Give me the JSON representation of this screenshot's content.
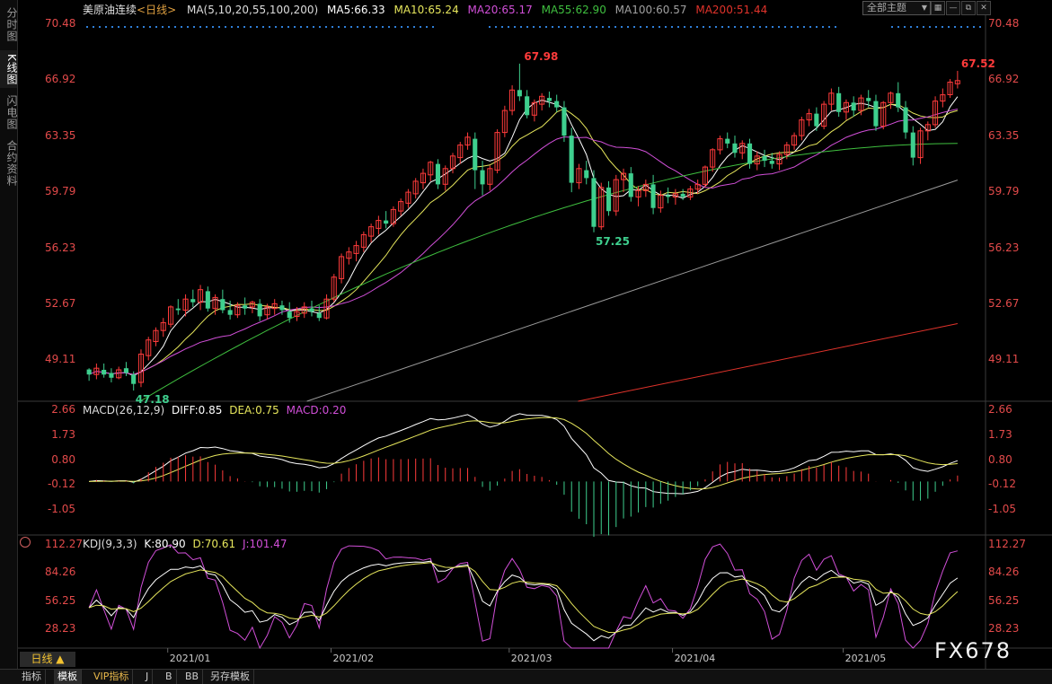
{
  "sidebar": {
    "tabs": [
      {
        "label": "分时图"
      },
      {
        "label": "K线图"
      },
      {
        "label": "闪电图"
      },
      {
        "label": "合约资料"
      }
    ]
  },
  "header": {
    "instrument": "美原油连续",
    "period_tag": "<日线>",
    "ma_params": "MA(5,10,20,55,100,200)",
    "ma5": "MA5:66.33",
    "ma10": "MA10:65.24",
    "ma20": "MA20:65.17",
    "ma55": "MA55:62.90",
    "ma100": "MA100:60.57",
    "ma200": "MA200:51.44",
    "theme_select": "全部主题",
    "theme_arrow": "▼"
  },
  "colors": {
    "up": "#ff3b3b",
    "down": "#3ecf8e",
    "ma5": "#ffffff",
    "ma10": "#e6e65c",
    "ma20": "#d14fd8",
    "ma55": "#3fbf3f",
    "ma100": "#9a9a9a",
    "ma200": "#e0332b",
    "axis_text": "#e34a4a",
    "grid_dots": "#2f7fd8"
  },
  "price_axis": {
    "labels": [
      "70.48",
      "66.92",
      "63.35",
      "59.79",
      "56.23",
      "52.67",
      "49.11"
    ]
  },
  "price_marks": {
    "high_label": "67.98",
    "low_label": "57.25",
    "first_low_label": "47.18",
    "last_label": "67.52"
  },
  "macd": {
    "title": "MACD(26,12,9)",
    "diff": "DIFF:0.85",
    "dea": "DEA:0.75",
    "macd": "MACD:0.20",
    "axis_labels": [
      "2.66",
      "1.73",
      "0.80",
      "-0.12",
      "-1.05"
    ]
  },
  "kdj": {
    "title": "KDJ(9,3,3)",
    "k": "K:80.90",
    "d": "D:70.61",
    "j": "J:101.47",
    "axis_labels": [
      "112.27",
      "84.26",
      "56.25",
      "28.23"
    ]
  },
  "dates": [
    "2021/01",
    "2021/02",
    "2021/03",
    "2021/04",
    "2021/05"
  ],
  "period_button": "日线 ▲",
  "bottom_tabs": [
    "指标",
    "模板",
    "VIP指标",
    "J",
    "B",
    "BB",
    "另存模板"
  ],
  "watermark": "FX678",
  "chart_data": {
    "type": "candlestick",
    "ohlc": [
      [
        48.52,
        48.6,
        47.8,
        48.2
      ],
      [
        48.2,
        48.9,
        47.9,
        48.6
      ],
      [
        48.5,
        48.9,
        48.0,
        48.2
      ],
      [
        48.3,
        48.6,
        47.7,
        48.0
      ],
      [
        48.0,
        48.7,
        47.9,
        48.5
      ],
      [
        48.6,
        49.0,
        48.1,
        48.3
      ],
      [
        48.2,
        48.4,
        47.18,
        47.6
      ],
      [
        47.7,
        49.8,
        47.4,
        49.5
      ],
      [
        49.4,
        50.6,
        49.1,
        50.4
      ],
      [
        50.3,
        51.2,
        50.0,
        51.0
      ],
      [
        51.0,
        51.8,
        50.6,
        51.5
      ],
      [
        51.4,
        52.6,
        51.2,
        52.5
      ],
      [
        52.4,
        53.0,
        52.0,
        52.3
      ],
      [
        52.3,
        53.3,
        51.9,
        53.0
      ],
      [
        53.0,
        53.6,
        52.5,
        52.8
      ],
      [
        52.8,
        53.9,
        52.3,
        53.6
      ],
      [
        53.5,
        53.8,
        52.2,
        52.4
      ],
      [
        52.4,
        53.3,
        52.0,
        53.1
      ],
      [
        53.0,
        53.6,
        52.1,
        52.3
      ],
      [
        52.3,
        52.9,
        51.7,
        52.0
      ],
      [
        52.0,
        52.8,
        51.8,
        52.6
      ],
      [
        52.6,
        53.1,
        52.0,
        52.4
      ],
      [
        52.5,
        52.9,
        52.1,
        52.8
      ],
      [
        52.7,
        53.0,
        51.6,
        51.9
      ],
      [
        52.0,
        52.7,
        51.7,
        52.5
      ],
      [
        52.4,
        53.0,
        52.0,
        52.7
      ],
      [
        52.6,
        52.9,
        52.0,
        52.3
      ],
      [
        52.2,
        52.8,
        51.5,
        51.8
      ],
      [
        51.9,
        52.5,
        51.6,
        52.2
      ],
      [
        52.1,
        52.8,
        51.8,
        52.5
      ],
      [
        52.4,
        52.9,
        51.9,
        52.2
      ],
      [
        52.1,
        52.6,
        51.6,
        51.8
      ],
      [
        51.8,
        53.3,
        51.7,
        53.0
      ],
      [
        53.0,
        54.6,
        52.8,
        54.4
      ],
      [
        54.3,
        55.9,
        54.0,
        55.7
      ],
      [
        55.6,
        56.3,
        55.2,
        56.0
      ],
      [
        55.9,
        56.7,
        55.4,
        56.4
      ],
      [
        56.3,
        57.3,
        56.0,
        57.1
      ],
      [
        57.0,
        57.8,
        56.6,
        57.6
      ],
      [
        57.5,
        58.3,
        57.1,
        58.0
      ],
      [
        58.0,
        58.6,
        57.5,
        57.8
      ],
      [
        57.8,
        58.9,
        57.6,
        58.7
      ],
      [
        58.6,
        59.4,
        58.3,
        59.2
      ],
      [
        59.1,
        60.0,
        58.8,
        59.8
      ],
      [
        59.7,
        60.7,
        59.4,
        60.5
      ],
      [
        60.4,
        61.3,
        60.0,
        61.0
      ],
      [
        60.9,
        61.8,
        60.5,
        61.7
      ],
      [
        61.6,
        61.9,
        60.0,
        60.3
      ],
      [
        60.3,
        61.5,
        59.9,
        61.3
      ],
      [
        61.3,
        62.3,
        61.0,
        62.1
      ],
      [
        62.0,
        63.0,
        61.6,
        62.8
      ],
      [
        62.8,
        63.6,
        62.5,
        63.3
      ],
      [
        63.2,
        63.6,
        60.0,
        61.2
      ],
      [
        61.2,
        61.8,
        59.6,
        60.3
      ],
      [
        60.3,
        61.5,
        59.9,
        61.3
      ],
      [
        61.2,
        63.8,
        61.0,
        63.6
      ],
      [
        63.6,
        65.3,
        63.3,
        65.0
      ],
      [
        65.0,
        66.6,
        64.7,
        66.3
      ],
      [
        66.3,
        67.98,
        65.6,
        65.9
      ],
      [
        65.9,
        66.3,
        64.5,
        64.7
      ],
      [
        64.7,
        65.7,
        64.3,
        65.5
      ],
      [
        65.4,
        66.1,
        65.0,
        65.9
      ],
      [
        65.8,
        66.2,
        65.2,
        65.6
      ],
      [
        65.6,
        66.0,
        64.9,
        65.2
      ],
      [
        65.2,
        65.6,
        63.0,
        63.4
      ],
      [
        63.4,
        63.9,
        59.8,
        60.4
      ],
      [
        60.4,
        61.6,
        60.0,
        61.3
      ],
      [
        61.2,
        61.8,
        60.3,
        60.7
      ],
      [
        60.7,
        61.2,
        57.25,
        57.6
      ],
      [
        57.6,
        60.4,
        57.4,
        60.1
      ],
      [
        60.1,
        60.5,
        58.3,
        58.6
      ],
      [
        58.6,
        60.9,
        58.3,
        60.6
      ],
      [
        60.6,
        61.3,
        59.8,
        61.0
      ],
      [
        61.0,
        61.4,
        59.2,
        59.5
      ],
      [
        59.5,
        60.2,
        58.9,
        59.9
      ],
      [
        59.9,
        60.6,
        59.5,
        60.3
      ],
      [
        60.3,
        60.9,
        58.4,
        58.8
      ],
      [
        58.8,
        59.9,
        58.5,
        59.6
      ],
      [
        59.6,
        60.1,
        59.1,
        59.5
      ],
      [
        59.5,
        60.0,
        59.0,
        59.7
      ],
      [
        59.7,
        60.0,
        59.3,
        59.5
      ],
      [
        59.5,
        60.2,
        59.3,
        60.0
      ],
      [
        60.0,
        60.6,
        59.7,
        60.3
      ],
      [
        60.3,
        61.5,
        60.1,
        61.4
      ],
      [
        61.4,
        62.6,
        61.1,
        62.5
      ],
      [
        62.5,
        63.4,
        62.2,
        63.2
      ],
      [
        63.2,
        63.6,
        62.6,
        62.9
      ],
      [
        62.9,
        63.4,
        62.0,
        62.3
      ],
      [
        62.3,
        63.1,
        61.9,
        62.9
      ],
      [
        62.9,
        63.2,
        61.3,
        61.6
      ],
      [
        61.6,
        62.4,
        61.2,
        62.1
      ],
      [
        62.1,
        62.5,
        61.4,
        61.8
      ],
      [
        61.8,
        62.3,
        61.3,
        61.6
      ],
      [
        61.6,
        62.4,
        61.2,
        62.2
      ],
      [
        62.2,
        63.0,
        61.9,
        62.8
      ],
      [
        62.8,
        63.6,
        62.5,
        63.4
      ],
      [
        63.4,
        64.6,
        63.1,
        64.4
      ],
      [
        64.4,
        65.1,
        64.0,
        64.8
      ],
      [
        64.8,
        65.2,
        63.7,
        64.0
      ],
      [
        64.0,
        65.6,
        63.8,
        65.4
      ],
      [
        65.4,
        66.4,
        65.0,
        66.1
      ],
      [
        66.1,
        66.5,
        64.6,
        64.9
      ],
      [
        64.9,
        65.7,
        64.4,
        65.5
      ],
      [
        65.5,
        65.9,
        64.6,
        65.0
      ],
      [
        65.0,
        66.0,
        64.7,
        65.8
      ],
      [
        65.8,
        66.3,
        65.2,
        65.6
      ],
      [
        65.6,
        66.0,
        63.7,
        64.0
      ],
      [
        64.0,
        65.6,
        63.8,
        65.5
      ],
      [
        65.5,
        66.2,
        65.1,
        66.1
      ],
      [
        66.1,
        66.8,
        64.9,
        65.2
      ],
      [
        65.2,
        65.6,
        63.2,
        63.6
      ],
      [
        63.6,
        64.0,
        61.5,
        62.0
      ],
      [
        62.0,
        63.9,
        61.6,
        63.7
      ],
      [
        63.7,
        64.3,
        63.1,
        64.1
      ],
      [
        64.1,
        65.9,
        63.9,
        65.6
      ],
      [
        65.6,
        66.4,
        65.2,
        66.0
      ],
      [
        66.0,
        67.0,
        65.8,
        66.8
      ],
      [
        66.7,
        67.52,
        66.4,
        66.9
      ]
    ],
    "ylim": [
      46.5,
      71.0
    ],
    "x_categories": [
      "2021/01",
      "2021/02",
      "2021/03",
      "2021/04",
      "2021/05"
    ]
  }
}
